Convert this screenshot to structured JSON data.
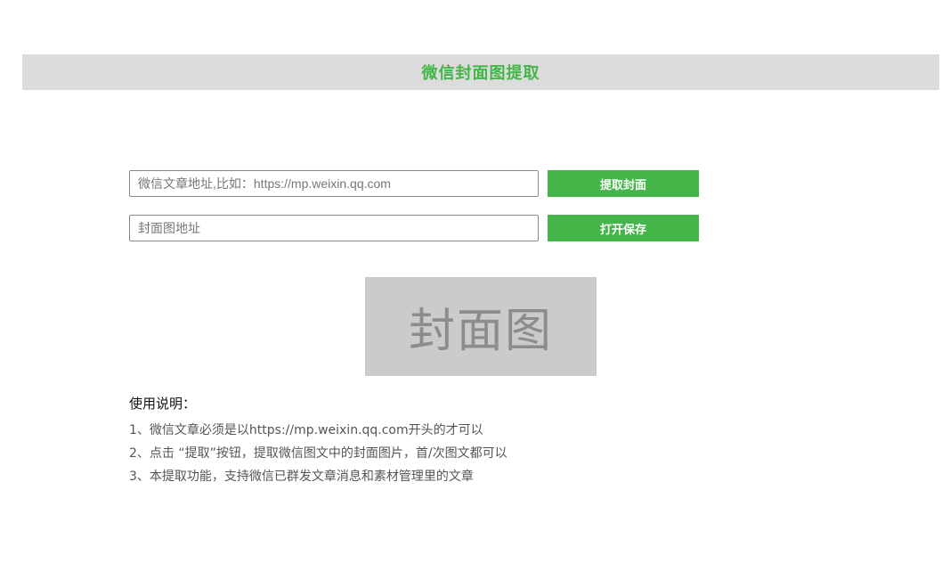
{
  "header": {
    "title": "微信封面图提取"
  },
  "form": {
    "article_url_placeholder": "微信文章地址,比如：https://mp.weixin.qq.com",
    "article_url_value": "",
    "extract_button_label": "提取封面",
    "cover_url_placeholder": "封面图地址",
    "cover_url_value": "",
    "open_save_button_label": "打开保存"
  },
  "cover_preview": {
    "text": "封面图"
  },
  "instructions": {
    "title": "使用说明：",
    "items": [
      "1、微信文章必须是以https://mp.weixin.qq.com开头的才可以",
      "2、点击 “提取”按钮，提取微信图文中的封面图片，首/次图文都可以",
      "3、本提取功能，支持微信已群发文章消息和素材管理里的文章"
    ]
  },
  "colors": {
    "accent": "#44b549",
    "header_bg": "#dcdcdc",
    "cover_bg": "#cbcbcb"
  }
}
